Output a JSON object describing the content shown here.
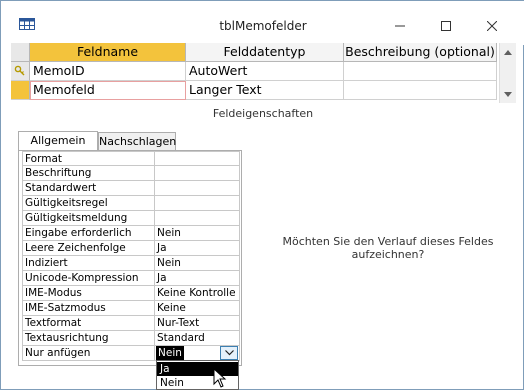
{
  "window": {
    "title": "tblMemofelder",
    "icons": [
      "table-icon",
      "minimize-icon",
      "maximize-icon",
      "close-icon"
    ]
  },
  "grid": {
    "headers": {
      "name": "Feldname",
      "type": "Felddatentyp",
      "desc": "Beschreibung (optional)"
    },
    "rows": [
      {
        "name": "MemoID",
        "type": "AutoWert",
        "desc": ""
      },
      {
        "name": "Memofeld",
        "type": "Langer Text",
        "desc": ""
      }
    ]
  },
  "section_title": "Feldeigenschaften",
  "tabs": {
    "general": "Allgemein",
    "lookup": "Nachschlagen"
  },
  "properties": [
    {
      "label": "Format",
      "value": ""
    },
    {
      "label": "Beschriftung",
      "value": ""
    },
    {
      "label": "Standardwert",
      "value": ""
    },
    {
      "label": "Gültigkeitsregel",
      "value": ""
    },
    {
      "label": "Gültigkeitsmeldung",
      "value": ""
    },
    {
      "label": "Eingabe erforderlich",
      "value": "Nein"
    },
    {
      "label": "Leere Zeichenfolge",
      "value": "Ja"
    },
    {
      "label": "Indiziert",
      "value": "Nein"
    },
    {
      "label": "Unicode-Kompression",
      "value": "Ja"
    },
    {
      "label": "IME-Modus",
      "value": "Keine Kontrolle"
    },
    {
      "label": "IME-Satzmodus",
      "value": "Keine"
    },
    {
      "label": "Textformat",
      "value": "Nur-Text"
    },
    {
      "label": "Textausrichtung",
      "value": "Standard"
    },
    {
      "label": "Nur anfügen",
      "value": ""
    }
  ],
  "append_only": {
    "selected": "Nein",
    "options": [
      "Ja",
      "Nein"
    ],
    "highlighted": "Ja"
  },
  "hint": "Möchten Sie den Verlauf dieses Feldes aufzeichnen?",
  "colors": {
    "header_active": "#f3c33c",
    "header": "#f4f4f4",
    "border": "#7f9db9"
  }
}
